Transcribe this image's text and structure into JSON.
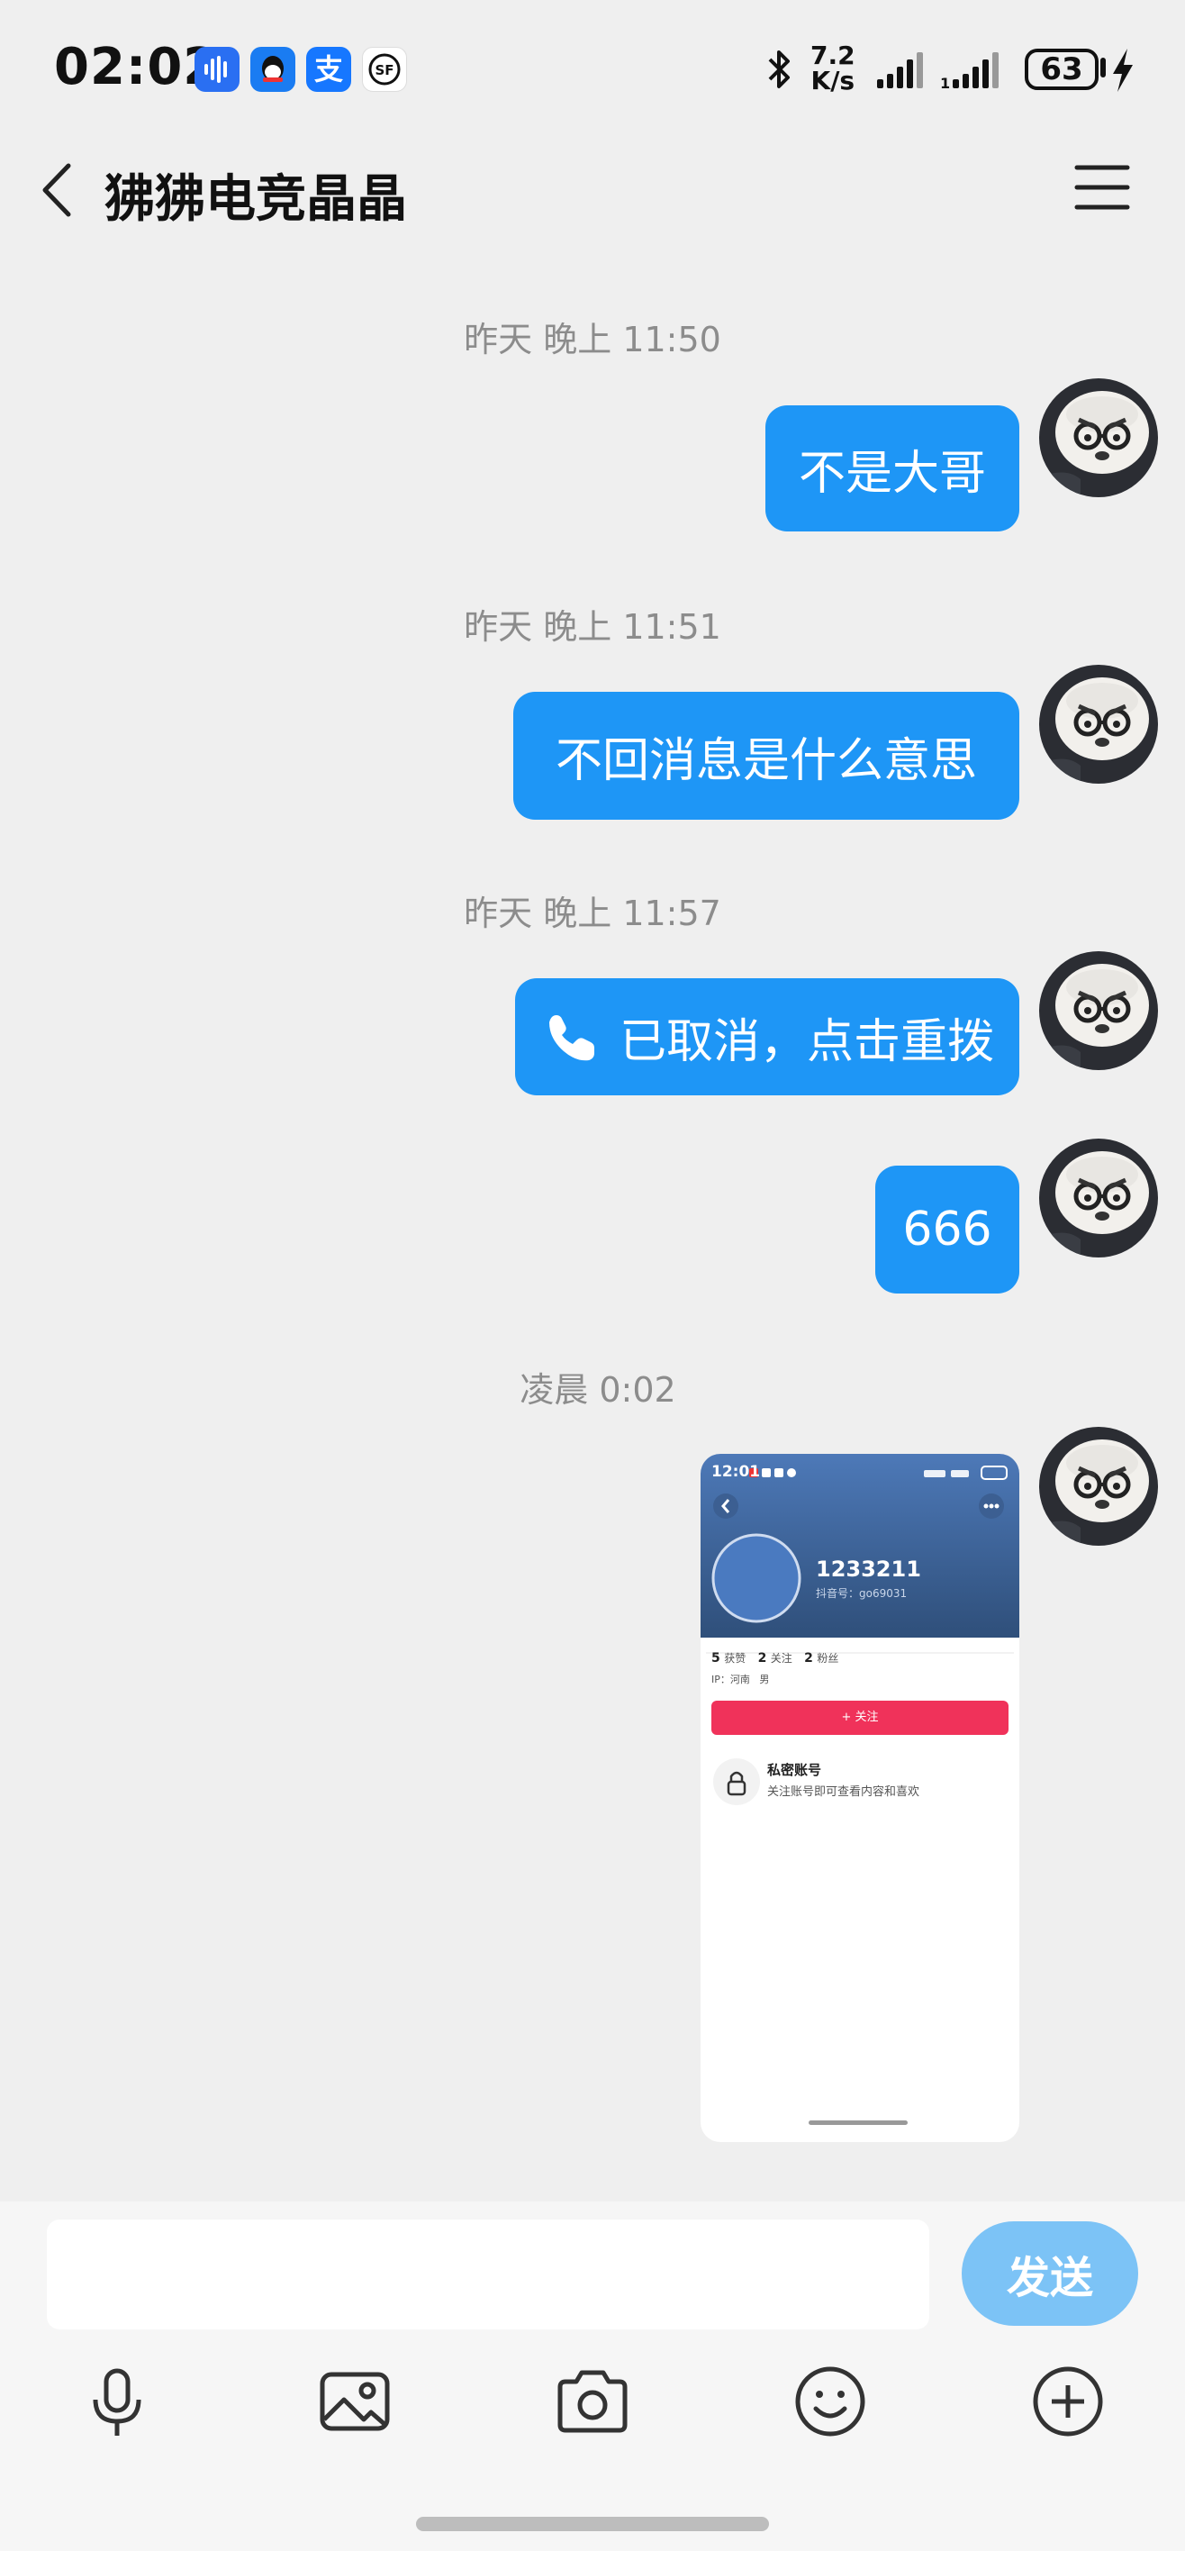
{
  "status_bar": {
    "time": "02:02",
    "net_speed_value": "7.2",
    "net_speed_unit": "K/s",
    "battery": "63",
    "icons": [
      "voice-assistant-icon",
      "qq-icon",
      "alipay-icon",
      "sf-express-icon",
      "bluetooth-icon",
      "signal-icon",
      "signal-2-icon",
      "charging-icon"
    ]
  },
  "header": {
    "title": "狒狒电竞晶晶"
  },
  "messages": [
    {
      "time": "昨天 晚上 11:50",
      "text": "不是大哥"
    },
    {
      "time": "昨天 晚上 11:51",
      "text": "不回消息是什么意思"
    },
    {
      "time": "昨天 晚上 11:57",
      "text": "已取消，点击重拨"
    },
    {
      "text": "666"
    },
    {
      "time": "凌晨 0:02"
    }
  ],
  "shared_screenshot": {
    "time": "12:01",
    "username": "1233211",
    "account_id": "抖音号：go69031",
    "stats": {
      "likes_count": "5",
      "likes_label": "获赞",
      "following_count": "2",
      "following_label": "关注",
      "followers_count": "2",
      "followers_label": "粉丝"
    },
    "ip_label": "IP：河南",
    "gender": "男",
    "follow_button": "+ 关注",
    "private_title": "私密账号",
    "private_desc": "关注账号即可查看内容和喜欢"
  },
  "input": {
    "placeholder": "",
    "send_label": "发送"
  },
  "colors": {
    "bubble": "#1e96f6",
    "send": "#7cc3f6",
    "follow": "#f0325a",
    "background": "#efefef"
  }
}
